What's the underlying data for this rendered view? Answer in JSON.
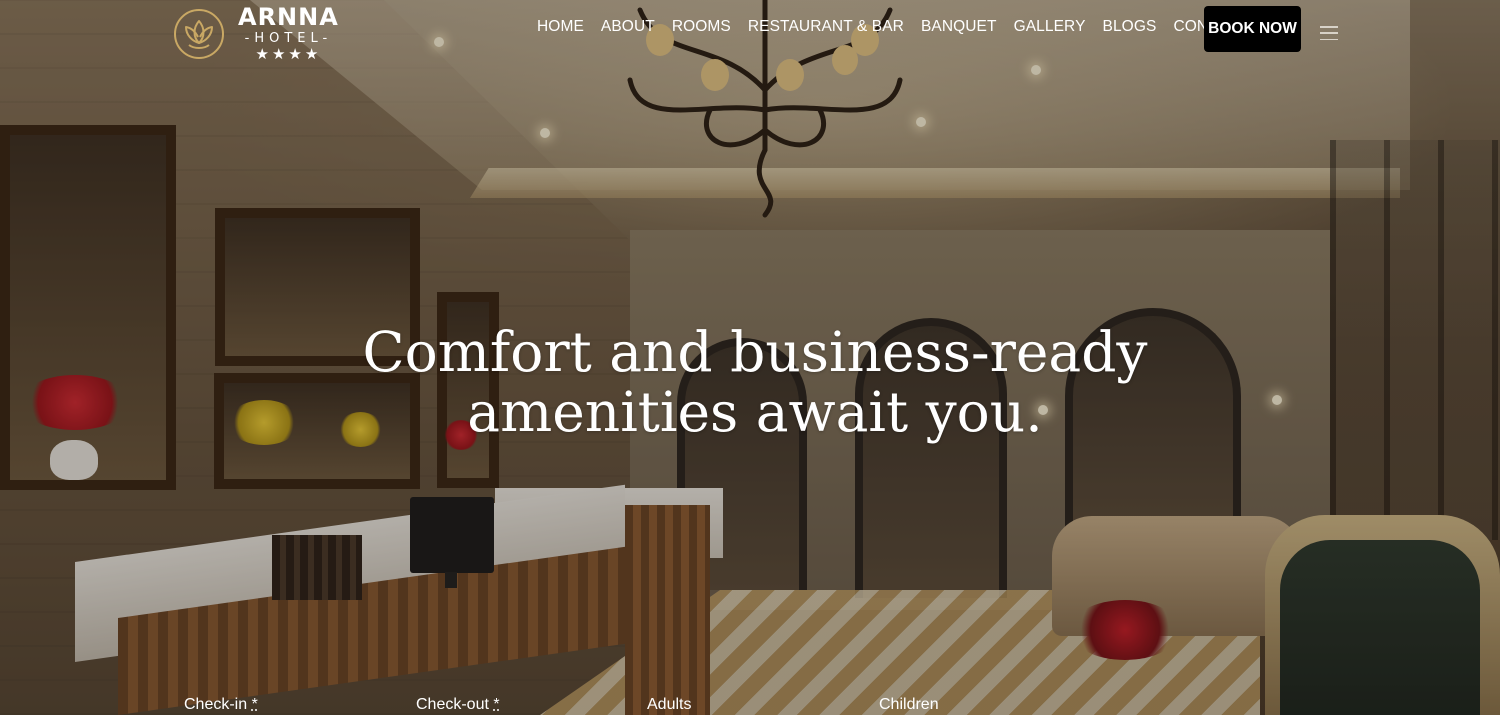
{
  "brand": {
    "name": "ARNNA",
    "sub": "HOTEL",
    "stars": "★★★★",
    "accent": "#c9a864"
  },
  "nav": {
    "items": [
      {
        "label": "HOME"
      },
      {
        "label": "ABOUT"
      },
      {
        "label": "ROOMS"
      },
      {
        "label": "RESTAURANT & BAR"
      },
      {
        "label": "BANQUET"
      },
      {
        "label": "GALLERY"
      },
      {
        "label": "BLOGS"
      },
      {
        "label": "CONTACT"
      }
    ],
    "book_label": "BOOK NOW",
    "menu_icon": "hamburger-menu-icon"
  },
  "hero": {
    "headline_line1": "Comfort and business-ready",
    "headline_line2": "amenities await you."
  },
  "booking": {
    "checkin_label": "Check-in",
    "checkout_label": "Check-out",
    "required_mark": "*",
    "adults_label": "Adults",
    "children_label": "Children"
  }
}
